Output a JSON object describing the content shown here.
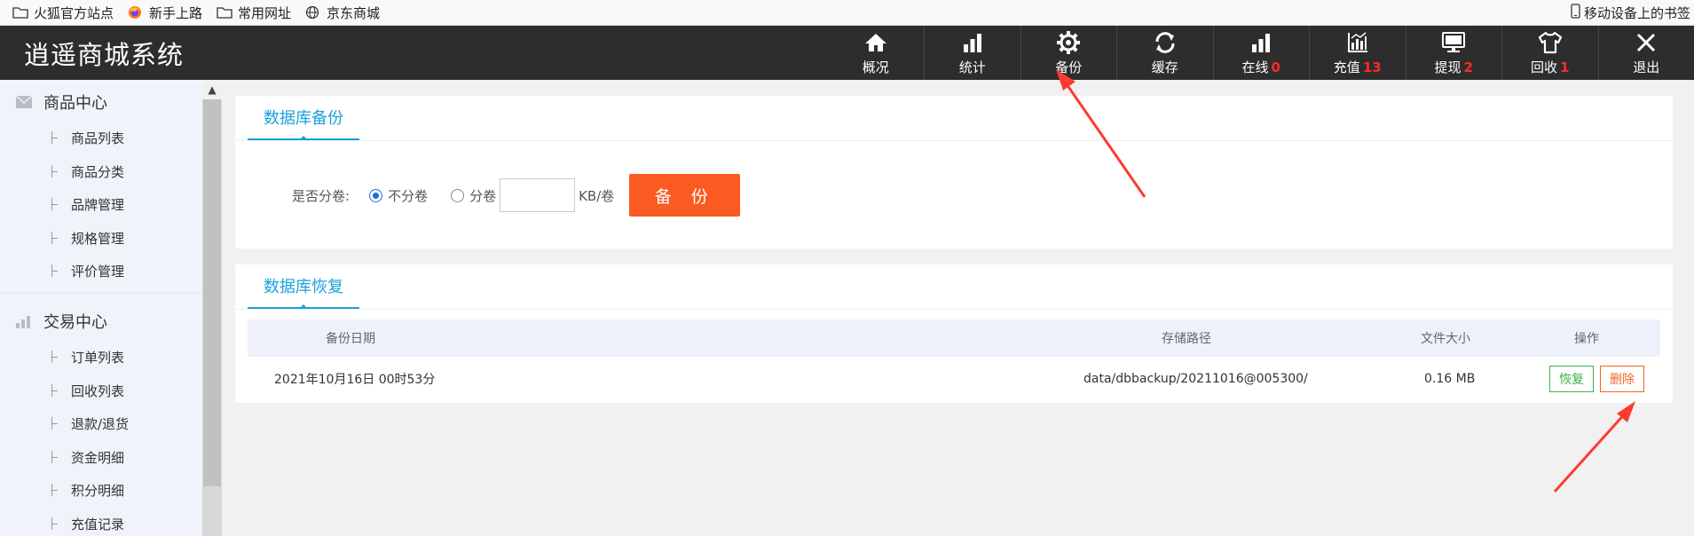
{
  "bookmarks": {
    "items": [
      {
        "label": "火狐官方站点",
        "icon": "folder-icon"
      },
      {
        "label": "新手上路",
        "icon": "firefox-icon"
      },
      {
        "label": "常用网址",
        "icon": "folder-icon"
      },
      {
        "label": "京东商城",
        "icon": "globe-icon"
      }
    ],
    "mobile": "移动设备上的书签"
  },
  "header": {
    "brand": "逍遥商城系统",
    "nav": [
      {
        "label": "概况",
        "icon": "home-icon",
        "count": ""
      },
      {
        "label": "统计",
        "icon": "bar-chart-icon",
        "count": ""
      },
      {
        "label": "备份",
        "icon": "gear-icon",
        "count": ""
      },
      {
        "label": "缓存",
        "icon": "refresh-icon",
        "count": ""
      },
      {
        "label": "在线",
        "icon": "online-chart-icon",
        "count": "0"
      },
      {
        "label": "充值",
        "icon": "recharge-chart-icon",
        "count": "13"
      },
      {
        "label": "提现",
        "icon": "monitor-icon",
        "count": "2"
      },
      {
        "label": "回收",
        "icon": "shirt-icon",
        "count": "1"
      },
      {
        "label": "退出",
        "icon": "close-icon",
        "count": ""
      }
    ]
  },
  "sidebar": {
    "groups": [
      {
        "title": "商品中心",
        "icon": "mail-icon",
        "items": [
          "商品列表",
          "商品分类",
          "品牌管理",
          "规格管理",
          "评价管理"
        ]
      },
      {
        "title": "交易中心",
        "icon": "bar-chart-icon",
        "items": [
          "订单列表",
          "回收列表",
          "退款/退货",
          "资金明细",
          "积分明细",
          "充值记录"
        ]
      }
    ]
  },
  "backup": {
    "tab": "数据库备份",
    "split_label": "是否分卷:",
    "no_split": "不分卷",
    "split": "分卷",
    "selected": "不分卷",
    "kb_value": "",
    "kb_unit": "KB/卷",
    "button": "备 份"
  },
  "restore": {
    "tab": "数据库恢复",
    "columns": [
      "备份日期",
      "存储路径",
      "文件大小",
      "操作"
    ],
    "rows": [
      {
        "date": "2021年10月16日 00时53分",
        "path": "data/dbbackup/20211016@005300/",
        "size": "0.16 MB",
        "restore": "恢复",
        "delete": "删除"
      }
    ]
  },
  "colors": {
    "accent": "#1aa0dc",
    "button": "#fb5a22",
    "topbar": "#2d2d2d",
    "badge": "#ff2a2a",
    "annotation": "#ff3b30"
  }
}
